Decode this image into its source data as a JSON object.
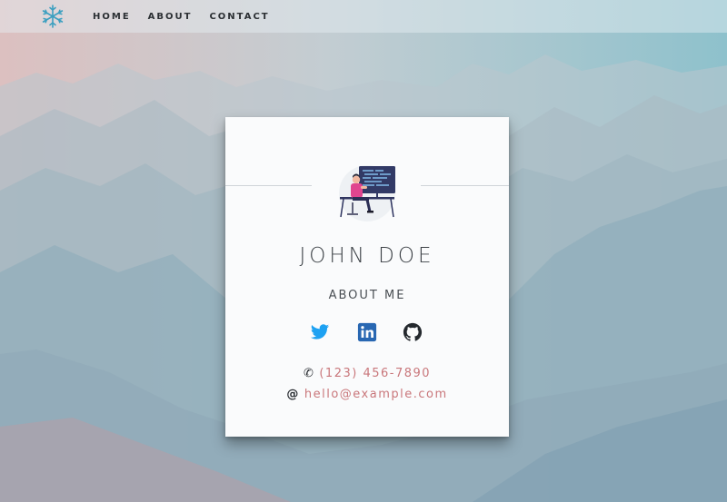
{
  "nav": {
    "logo_icon": "snowflake-icon",
    "links": [
      "HOME",
      "ABOUT",
      "CONTACT"
    ]
  },
  "card": {
    "avatar_icon": "developer-at-desk-illustration",
    "name": "JOHN DOE",
    "about_label": "ABOUT ME",
    "social": [
      {
        "name": "twitter",
        "icon": "twitter-icon",
        "color": "#1da1f2"
      },
      {
        "name": "linkedin",
        "icon": "linkedin-icon",
        "color": "#2867b2"
      },
      {
        "name": "github",
        "icon": "github-icon",
        "color": "#24292e"
      }
    ],
    "phone": "(123) 456-7890",
    "email": "hello@example.com",
    "accent_color": "#c9777b"
  }
}
